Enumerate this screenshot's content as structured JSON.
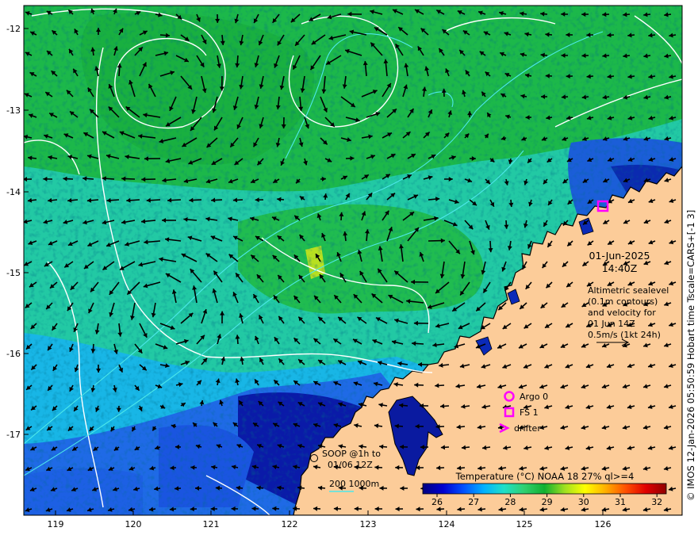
{
  "map": {
    "lat_ticks": [
      "-12",
      "-13",
      "-14",
      "-15",
      "-16",
      "-17"
    ],
    "lon_ticks": [
      "119",
      "120",
      "121",
      "122",
      "123",
      "124",
      "125",
      "126"
    ],
    "lat_range": [
      -17.95,
      -11.75
    ],
    "lon_range": [
      118.6,
      127.0
    ],
    "colors": {
      "land": "#fccc99",
      "arrow": "#000000",
      "contour": "#ffffff",
      "isobath": "#4de8ea",
      "marker": "#ff00ff"
    }
  },
  "annotations": {
    "date": "01-Jun-2025",
    "time": "14:40Z",
    "alt_line1": "Altimetric sealevel",
    "alt_line2": "(0.1m contours)",
    "alt_line3": "and velocity for",
    "alt_line4": "01 Jun 14Z",
    "scale_label": "0.5m/s (1kt 24h)",
    "soop_line1": "SOOP @1h to",
    "soop_line2": "01/06 12Z",
    "isobath_label": "200  1000m"
  },
  "legend": {
    "argo": "Argo 0",
    "fs": "FS 1",
    "drifter": "drifter"
  },
  "colorbar": {
    "title": "Temperature (°C) NOAA 18 27% ql>=4",
    "ticks": [
      "26",
      "27",
      "28",
      "29",
      "30",
      "31",
      "32"
    ],
    "colors": [
      "#000080",
      "#0000d0",
      "#0050ff",
      "#00b0ff",
      "#20e0c8",
      "#30d070",
      "#10b030",
      "#a0e020",
      "#ffff00",
      "#ffb000",
      "#ff5000",
      "#e00000",
      "#900000"
    ]
  },
  "side_text": "© IMOS 12-Jan-2026 05:50:59 Hobart time Tscale=CARS+[-1 3]"
}
